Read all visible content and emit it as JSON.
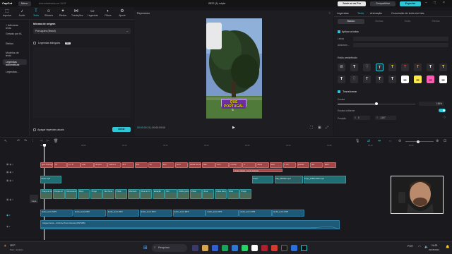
{
  "titlebar": {
    "app": "CapCut",
    "menu_label": "Menu",
    "path": "Auto-salvamento em 14:19",
    "project_title": "0522 (1) cópia",
    "upgrade_label": "Junte-se ao Pro",
    "share_label": "Compartilhar",
    "export_label": "Exportar"
  },
  "toolbar": {
    "items": [
      "Importar",
      "Áudio",
      "Texto",
      "Stickers",
      "Efeitos",
      "Transições",
      "Legendas",
      "Filtros",
      "Ajuste"
    ]
  },
  "leftnav": {
    "items": [
      "+ Adicionar texto",
      "Gerado por IA",
      "Efeitos",
      "Modelos de texto",
      "Legendas automáticas",
      "Legendas..."
    ],
    "active_index": 4
  },
  "caption_panel": {
    "source_lang_label": "Idioma de origem",
    "source_lang_value": "Português (Brasil)",
    "bilingual_label": "Legendas bilíngues",
    "bilingual_badge": "PRO",
    "delete_label": "Apagar legendas atuais",
    "generate_label": "Gerar"
  },
  "player": {
    "label": "Reprodutor",
    "caption_text": "QUE PORTUGAL",
    "time_current": "00:00:00:15",
    "time_total": "00:00:09:00"
  },
  "right_panel": {
    "tabs": [
      "Legendas",
      "Texto",
      "Animação",
      "Conversão de texto em fala"
    ],
    "active_tab": 1,
    "subtabs": [
      "Básico",
      "Bolhas",
      "Estilo",
      "Efeitos"
    ],
    "apply_all": "Aplicar a todos",
    "row_labels": [
      "Letras",
      "Alinhame..."
    ],
    "preset_label": "Estilo predefinido",
    "transform_label": "Transformar",
    "scale_label": "Escala",
    "scale_value": 1.5,
    "scale_text": "156%",
    "uniform_label": "Escala uniforme",
    "position_label": "Posição",
    "pos_x_text": "X",
    "pos_x_value": "0",
    "pos_y_text": "Y",
    "pos_y_value": "-1107"
  },
  "timeline": {
    "cover_label": "Capa",
    "caption_clips": [
      "Que Portugal",
      "Oi",
      "e o Ti",
      "que",
      "de pes",
      "sobre a",
      "de f",
      "fica",
      "on",
      "tem",
      "ao m",
      "deixar de ser",
      "fala",
      "com",
      "o portu",
      "a",
      "deixa",
      "aqui",
      "e um",
      "grande",
      "nos",
      "alem"
    ],
    "selected_caption": "Qual cidade / você gostaria",
    "video_clips": [
      "Praça de Itália",
      "Parque M",
      "Monumento",
      "Paço",
      "Prego",
      "Vila Nova",
      "Praia",
      "Mercado",
      "Rua do Cl",
      "Estação",
      "Rio",
      "Utilize junto ao Cais",
      "Vídeo",
      "Área",
      "Antes das paredes",
      "Vista",
      "Praça"
    ],
    "overlay_clips": [
      "Título.mp4",
      "Vila_000032.mp4",
      "Logo_1080x1920.mp4"
    ],
    "audio_clips": [
      "áudio_texto.MP3",
      "áudio_texto.MP3",
      "áudio_texto.MP3",
      "áudio_texto.MP3",
      "áudio_texto.MP3",
      "áudio_texto.MP3",
      "áudio_texto.MP3",
      "áudio_texto.MP3"
    ],
    "music_label": "Aluguel tense - Artist de Pons Floresta (W27286)",
    "ticks": [
      "00:00",
      "00:05",
      "00:10",
      "00:15",
      "00:20",
      "00:25",
      "00:30",
      "00:35",
      "00:40",
      "00:45"
    ]
  },
  "taskbar": {
    "search_placeholder": "Pesquisar",
    "weather_temp": "19°C",
    "weather_desc": "Parc. nublado",
    "time": "14:21",
    "date": "22/05/2024",
    "lang": "POR"
  },
  "colors": {
    "accent": "#2fc7d6",
    "caption": "#a04646",
    "video": "#1f6e73",
    "audio": "#1c5a77"
  }
}
